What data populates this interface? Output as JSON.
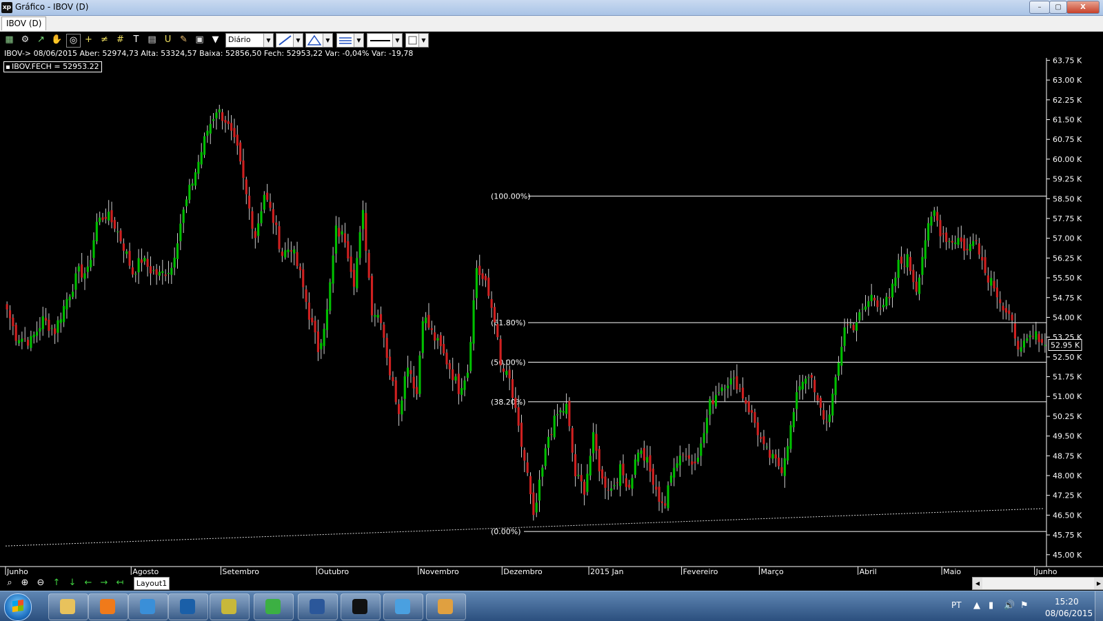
{
  "window": {
    "title": "Gráfico - IBOV (D)",
    "app_icon_text": "xp",
    "minimize_glyph": "–",
    "maximize_glyph": "▢",
    "close_glyph": "X"
  },
  "tabs": [
    {
      "label": "IBOV (D)"
    }
  ],
  "toolbar": {
    "icons": [
      "chart-icon",
      "gear-icon",
      "indicator-icon",
      "hand-icon",
      "zoom-chart-icon",
      "crosshair-icon",
      "horizontal-line-icon",
      "grid-icon",
      "text-icon",
      "calculator-icon",
      "magnet-icon",
      "brush-icon",
      "clipboard-icon",
      "filter-icon"
    ],
    "glyphs": [
      "▦",
      "⚙",
      "↗",
      "✋",
      "◎",
      "+",
      "≠",
      "#",
      "T",
      "▤",
      "U",
      "✎",
      "▣",
      "▼"
    ],
    "period": "Diário",
    "dropdown_arrow": "▼"
  },
  "info_line": "IBOV-> 08/06/2015 Aber: 52974,73 Alta: 53324,57 Baixa: 52856,50 Fech: 52953,22 Var: -0,04% Var: -19,78",
  "legend_label": "IBOV.FECH = 52953.22",
  "bottom_bar": {
    "nav_icons": [
      "zoom-fit-icon",
      "zoom-in-icon",
      "zoom-out-icon",
      "arrow-up-icon",
      "arrow-down-icon",
      "arrow-left-icon",
      "arrow-right-icon",
      "arrow-end-icon"
    ],
    "nav_glyphs": [
      "⌕",
      "⊕",
      "⊖",
      "↑",
      "↓",
      "←",
      "→",
      "↤"
    ],
    "layout_tab": "Layout1",
    "scroll_left": "◀",
    "scroll_right": "▶"
  },
  "taskbar": {
    "apps": [
      "file-explorer-icon",
      "media-player-icon",
      "network-icon",
      "hp-icon",
      "image-scanner-icon",
      "chrome-icon",
      "word-icon",
      "xp-app-icon",
      "photo-viewer-icon",
      "paint-icon"
    ],
    "app_colors": [
      "#e8c25c",
      "#f07a1a",
      "#3a8fd8",
      "#1a5fa8",
      "#c8b83a",
      "#3cb043",
      "#2b579a",
      "#111111",
      "#4aa0e0",
      "#e0a040"
    ],
    "language": "PT",
    "tray_glyphs": [
      "▲",
      "▮",
      "🔊",
      "⚑"
    ],
    "time": "15:20",
    "date": "08/06/2015"
  },
  "colors": {
    "up_candle": "#00c000",
    "down_candle": "#d02020",
    "background": "#000000",
    "axis_text": "#ffffff",
    "fib_line": "#ffffff",
    "moving_average": "#d8d8d8",
    "current_price_box": "#ffffff"
  },
  "chart_data": {
    "type": "candlestick",
    "symbol": "IBOV",
    "period": "Diário",
    "y_axis": {
      "ticks": [
        "45.00 K",
        "45.75 K",
        "46.50 K",
        "47.25 K",
        "48.00 K",
        "48.75 K",
        "49.50 K",
        "50.25 K",
        "51.00 K",
        "51.75 K",
        "52.50 K",
        "53.25 K",
        "54.00 K",
        "54.75 K",
        "55.50 K",
        "56.25 K",
        "57.00 K",
        "57.75 K",
        "58.50 K",
        "59.25 K",
        "60.00 K",
        "60.75 K",
        "61.50 K",
        "62.25 K",
        "63.00 K",
        "63.75 K"
      ],
      "tick_values": [
        45000,
        45750,
        46500,
        47250,
        48000,
        48750,
        49500,
        50250,
        51000,
        51750,
        52500,
        53250,
        54000,
        54750,
        55500,
        56250,
        57000,
        57750,
        58500,
        59250,
        60000,
        60750,
        61500,
        62250,
        63000,
        63750
      ],
      "range": [
        44550,
        63840
      ]
    },
    "x_axis": {
      "months": [
        {
          "label": "Junho",
          "bar_index": 0
        },
        {
          "label": "Agosto",
          "bar_index": 42
        },
        {
          "label": "Setembro",
          "bar_index": 72
        },
        {
          "label": "Outubro",
          "bar_index": 104
        },
        {
          "label": "Novembro",
          "bar_index": 138
        },
        {
          "label": "Dezembro",
          "bar_index": 166
        },
        {
          "label": "2015 Jan",
          "bar_index": 195
        },
        {
          "label": "Fevereiro",
          "bar_index": 226
        },
        {
          "label": "Março",
          "bar_index": 252
        },
        {
          "label": "Abril",
          "bar_index": 285
        },
        {
          "label": "Maio",
          "bar_index": 313
        },
        {
          "label": "Junho",
          "bar_index": 344
        }
      ]
    },
    "anchors": [
      {
        "i": 0,
        "close": 54300
      },
      {
        "i": 3,
        "close": 53300
      },
      {
        "i": 8,
        "close": 53100
      },
      {
        "i": 12,
        "close": 53900
      },
      {
        "i": 16,
        "close": 53500
      },
      {
        "i": 20,
        "close": 54700
      },
      {
        "i": 24,
        "close": 55700
      },
      {
        "i": 27,
        "close": 55700
      },
      {
        "i": 30,
        "close": 57600
      },
      {
        "i": 33,
        "close": 57900
      },
      {
        "i": 36,
        "close": 57500
      },
      {
        "i": 39,
        "close": 56700
      },
      {
        "i": 42,
        "close": 55700
      },
      {
        "i": 45,
        "close": 56200
      },
      {
        "i": 48,
        "close": 55800
      },
      {
        "i": 51,
        "close": 55600
      },
      {
        "i": 55,
        "close": 55900
      },
      {
        "i": 58,
        "close": 57600
      },
      {
        "i": 61,
        "close": 58800
      },
      {
        "i": 64,
        "close": 59900
      },
      {
        "i": 67,
        "close": 61100
      },
      {
        "i": 70,
        "close": 61900
      },
      {
        "i": 73,
        "close": 61500
      },
      {
        "i": 77,
        "close": 60300
      },
      {
        "i": 80,
        "close": 58600
      },
      {
        "i": 83,
        "close": 57100
      },
      {
        "i": 86,
        "close": 58700
      },
      {
        "i": 89,
        "close": 57700
      },
      {
        "i": 92,
        "close": 56400
      },
      {
        "i": 95,
        "close": 56700
      },
      {
        "i": 98,
        "close": 55600
      },
      {
        "i": 101,
        "close": 54100
      },
      {
        "i": 104,
        "close": 52800
      },
      {
        "i": 107,
        "close": 54200
      },
      {
        "i": 110,
        "close": 57300
      },
      {
        "i": 113,
        "close": 57000
      },
      {
        "i": 116,
        "close": 55400
      },
      {
        "i": 119,
        "close": 57900
      },
      {
        "i": 122,
        "close": 54300
      },
      {
        "i": 125,
        "close": 54000
      },
      {
        "i": 128,
        "close": 51900
      },
      {
        "i": 131,
        "close": 50500
      },
      {
        "i": 134,
        "close": 52300
      },
      {
        "i": 137,
        "close": 51100
      },
      {
        "i": 139,
        "close": 54100
      },
      {
        "i": 142,
        "close": 53400
      },
      {
        "i": 145,
        "close": 52800
      },
      {
        "i": 148,
        "close": 52100
      },
      {
        "i": 151,
        "close": 51300
      },
      {
        "i": 154,
        "close": 52000
      },
      {
        "i": 157,
        "close": 55900
      },
      {
        "i": 160,
        "close": 55200
      },
      {
        "i": 163,
        "close": 54000
      },
      {
        "i": 165,
        "close": 52100
      },
      {
        "i": 168,
        "close": 51600
      },
      {
        "i": 171,
        "close": 49700
      },
      {
        "i": 174,
        "close": 48000
      },
      {
        "i": 176,
        "close": 46300
      },
      {
        "i": 178,
        "close": 47600
      },
      {
        "i": 181,
        "close": 49500
      },
      {
        "i": 184,
        "close": 50300
      },
      {
        "i": 187,
        "close": 50600
      },
      {
        "i": 190,
        "close": 48000
      },
      {
        "i": 193,
        "close": 47500
      },
      {
        "i": 196,
        "close": 49400
      },
      {
        "i": 199,
        "close": 47800
      },
      {
        "i": 202,
        "close": 47500
      },
      {
        "i": 205,
        "close": 48200
      },
      {
        "i": 208,
        "close": 47600
      },
      {
        "i": 211,
        "close": 49000
      },
      {
        "i": 214,
        "close": 48500
      },
      {
        "i": 217,
        "close": 47300
      },
      {
        "i": 220,
        "close": 46900
      },
      {
        "i": 223,
        "close": 48500
      },
      {
        "i": 226,
        "close": 48900
      },
      {
        "i": 229,
        "close": 48500
      },
      {
        "i": 232,
        "close": 49100
      },
      {
        "i": 235,
        "close": 50700
      },
      {
        "i": 238,
        "close": 51300
      },
      {
        "i": 241,
        "close": 51600
      },
      {
        "i": 244,
        "close": 51500
      },
      {
        "i": 247,
        "close": 50800
      },
      {
        "i": 250,
        "close": 50000
      },
      {
        "i": 253,
        "close": 49000
      },
      {
        "i": 256,
        "close": 48600
      },
      {
        "i": 259,
        "close": 48300
      },
      {
        "i": 262,
        "close": 49800
      },
      {
        "i": 265,
        "close": 51500
      },
      {
        "i": 268,
        "close": 51900
      },
      {
        "i": 271,
        "close": 50700
      },
      {
        "i": 274,
        "close": 50000
      },
      {
        "i": 277,
        "close": 51500
      },
      {
        "i": 280,
        "close": 53700
      },
      {
        "i": 283,
        "close": 53700
      },
      {
        "i": 286,
        "close": 54200
      },
      {
        "i": 289,
        "close": 54800
      },
      {
        "i": 292,
        "close": 54500
      },
      {
        "i": 295,
        "close": 54600
      },
      {
        "i": 298,
        "close": 56000
      },
      {
        "i": 301,
        "close": 56200
      },
      {
        "i": 304,
        "close": 55100
      },
      {
        "i": 307,
        "close": 57000
      },
      {
        "i": 310,
        "close": 58000
      },
      {
        "i": 312,
        "close": 57300
      },
      {
        "i": 315,
        "close": 56900
      },
      {
        "i": 318,
        "close": 57000
      },
      {
        "i": 321,
        "close": 56500
      },
      {
        "i": 324,
        "close": 57100
      },
      {
        "i": 327,
        "close": 55700
      },
      {
        "i": 330,
        "close": 55300
      },
      {
        "i": 333,
        "close": 54300
      },
      {
        "i": 336,
        "close": 53700
      },
      {
        "i": 339,
        "close": 52700
      },
      {
        "i": 342,
        "close": 53200
      },
      {
        "i": 345,
        "close": 53300
      },
      {
        "i": 347,
        "close": 52953
      }
    ],
    "last_close": 52953.22,
    "current_price_label": "52.95 K",
    "fibonacci": [
      {
        "label": "(100.00%)",
        "value": 58600
      },
      {
        "label": "(61.80%)",
        "value": 53800
      },
      {
        "label": "(50.00%)",
        "value": 52300
      },
      {
        "label": "(38.20%)",
        "value": 50800
      },
      {
        "label": "(0.00%)",
        "value": 45880
      }
    ],
    "moving_average": {
      "start": 45330,
      "end": 46750
    },
    "grid": false,
    "legend": "top-left"
  }
}
